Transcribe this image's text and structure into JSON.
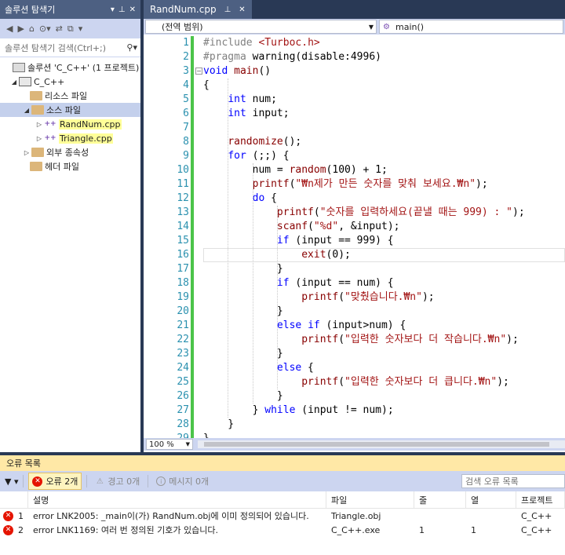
{
  "solution_explorer": {
    "title": "솔루션 탐색기",
    "search_placeholder": "솔루션 탐색기 검색(Ctrl+;)",
    "tree": [
      {
        "label": "솔루션 'C_C++' (1 프로젝트)",
        "icon": "solution-icon",
        "arrow": ""
      },
      {
        "label": "C_C++",
        "icon": "project-icon",
        "arrow": "expanded"
      },
      {
        "label": "리소스 파일",
        "icon": "folder-icon",
        "arrow": ""
      },
      {
        "label": "소스 파일",
        "icon": "folder-icon",
        "arrow": "expanded"
      },
      {
        "label": "RandNum.cpp",
        "icon": "cpp-file-icon",
        "arrow": "collapsed"
      },
      {
        "label": "Triangle.cpp",
        "icon": "cpp-file-icon",
        "arrow": "collapsed"
      },
      {
        "label": "외부 종속성",
        "icon": "folder-icon",
        "arrow": "collapsed"
      },
      {
        "label": "헤더 파일",
        "icon": "folder-icon",
        "arrow": ""
      }
    ]
  },
  "editor": {
    "tab_label": "RandNum.cpp",
    "scope_dropdown": "(전역 범위)",
    "member_dropdown": "main()",
    "zoom": "100 %",
    "lines": [
      {
        "n": "1",
        "text": "#include <Turboc.h>"
      },
      {
        "n": "2",
        "text": "#pragma warning(disable:4996)"
      },
      {
        "n": "3",
        "text": "void main()"
      },
      {
        "n": "4",
        "text": "{"
      },
      {
        "n": "5",
        "text": "    int num;"
      },
      {
        "n": "6",
        "text": "    int input;"
      },
      {
        "n": "7",
        "text": ""
      },
      {
        "n": "8",
        "text": "    randomize();"
      },
      {
        "n": "9",
        "text": "    for (;;) {"
      },
      {
        "n": "10",
        "text": "        num = random(100) + 1;"
      },
      {
        "n": "11",
        "text": "        printf(\"₩n제가 만든 숫자를 맞춰 보세요.₩n\");"
      },
      {
        "n": "12",
        "text": "        do {"
      },
      {
        "n": "13",
        "text": "            printf(\"숫자를 입력하세요(끝낼 때는 999) : \");"
      },
      {
        "n": "14",
        "text": "            scanf(\"%d\", &input);"
      },
      {
        "n": "15",
        "text": "            if (input == 999) {"
      },
      {
        "n": "16",
        "text": "                exit(0);"
      },
      {
        "n": "17",
        "text": "            }"
      },
      {
        "n": "18",
        "text": "            if (input == num) {"
      },
      {
        "n": "19",
        "text": "                printf(\"맞췄습니다.₩n\");"
      },
      {
        "n": "20",
        "text": "            }"
      },
      {
        "n": "21",
        "text": "            else if (input>num) {"
      },
      {
        "n": "22",
        "text": "                printf(\"입력한 숫자보다 더 작습니다.₩n\");"
      },
      {
        "n": "23",
        "text": "            }"
      },
      {
        "n": "24",
        "text": "            else {"
      },
      {
        "n": "25",
        "text": "                printf(\"입력한 숫자보다 더 큽니다.₩n\");"
      },
      {
        "n": "26",
        "text": "            }"
      },
      {
        "n": "27",
        "text": "        } while (input != num);"
      },
      {
        "n": "28",
        "text": "    }"
      },
      {
        "n": "29",
        "text": "}"
      }
    ]
  },
  "error_list": {
    "title": "오류 목록",
    "errors_button": "오류 2개",
    "warnings_button": "경고 0개",
    "messages_button": "메시지 0개",
    "search_placeholder": "검색 오류 목록",
    "columns": [
      "",
      "설명",
      "파일",
      "줄",
      "열",
      "프로젝트"
    ],
    "rows": [
      {
        "num": "1",
        "desc": "error LNK2005: _main이(가) RandNum.obj에 이미 정의되어 있습니다.",
        "file": "Triangle.obj",
        "line": "",
        "col": "",
        "project": "C_C++"
      },
      {
        "num": "2",
        "desc": "error LNK1169: 여러 번 정의된 기호가 있습니다.",
        "file": "C_C++.exe",
        "line": "1",
        "col": "1",
        "project": "C_C++"
      }
    ]
  },
  "colors": {
    "frame": "#293955",
    "panel_title": "#4d6082",
    "toolbar": "#ccd5f0",
    "change_bar": "#4bc449",
    "error_title": "#ffe8a6",
    "error_icon": "#e51400",
    "line_number": "#2b91af",
    "keyword": "#0000ff",
    "string": "#a31515"
  }
}
